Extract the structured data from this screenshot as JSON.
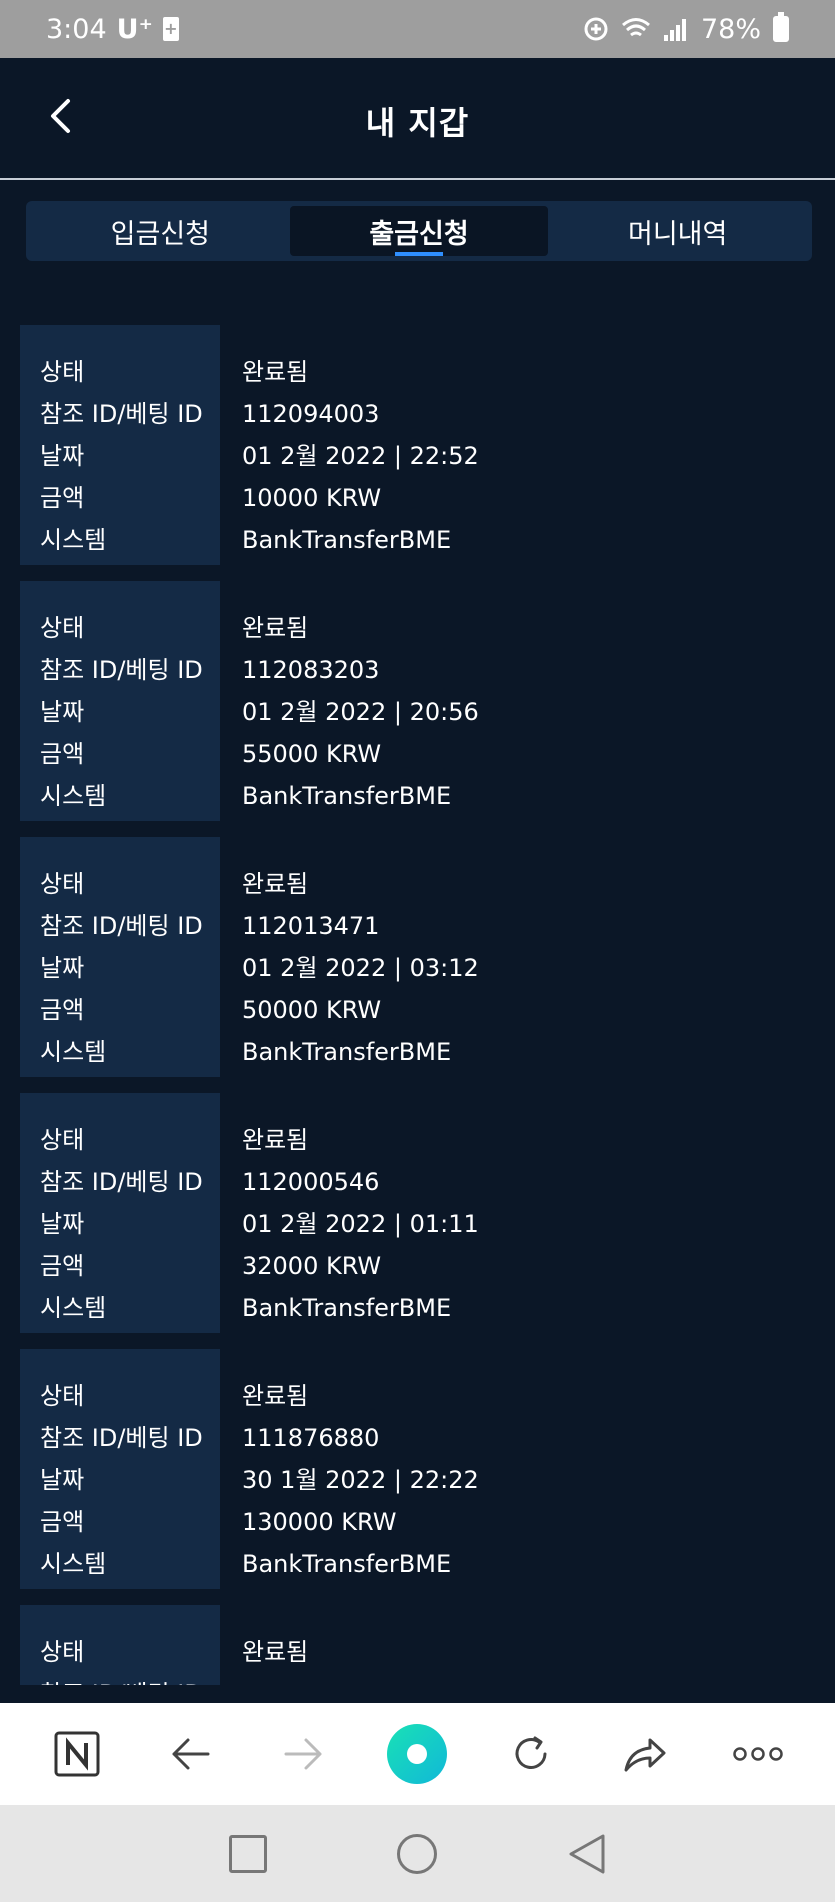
{
  "status_bar": {
    "time": "3:04",
    "carrier": "U⁺",
    "battery": "78%"
  },
  "header": {
    "title": "내 지갑"
  },
  "tabs": [
    {
      "label": "입금신청"
    },
    {
      "label": "출금신청"
    },
    {
      "label": "머니내역"
    }
  ],
  "active_tab": "출금신청",
  "labels": {
    "status": "상태",
    "ref_id": "참조 ID/베팅 ID",
    "date": "날짜",
    "amount": "금액",
    "system": "시스템"
  },
  "records": [
    {
      "status": "완료됨",
      "ref_id": "112094003",
      "date": "01 2월 2022 | 22:52",
      "amount": "10000 KRW",
      "system": "BankTransferBME"
    },
    {
      "status": "완료됨",
      "ref_id": "112083203",
      "date": "01 2월 2022 | 20:56",
      "amount": "55000 KRW",
      "system": "BankTransferBME"
    },
    {
      "status": "완료됨",
      "ref_id": "112013471",
      "date": "01 2월 2022 | 03:12",
      "amount": "50000 KRW",
      "system": "BankTransferBME"
    },
    {
      "status": "완료됨",
      "ref_id": "112000546",
      "date": "01 2월 2022 | 01:11",
      "amount": "32000 KRW",
      "system": "BankTransferBME"
    },
    {
      "status": "완료됨",
      "ref_id": "111876880",
      "date": "30 1월 2022 | 22:22",
      "amount": "130000 KRW",
      "system": "BankTransferBME"
    },
    {
      "status": "완료됨",
      "ref_id": "",
      "date": "",
      "amount": "",
      "system": ""
    }
  ],
  "browser_bar": {
    "icons": [
      "naver-icon",
      "back-arrow-icon",
      "forward-arrow-icon",
      "home-orb-icon",
      "refresh-icon",
      "share-icon",
      "more-icon"
    ]
  },
  "colors": {
    "background": "#0b1727",
    "panel": "#142a45",
    "accent": "#2f8fff"
  }
}
